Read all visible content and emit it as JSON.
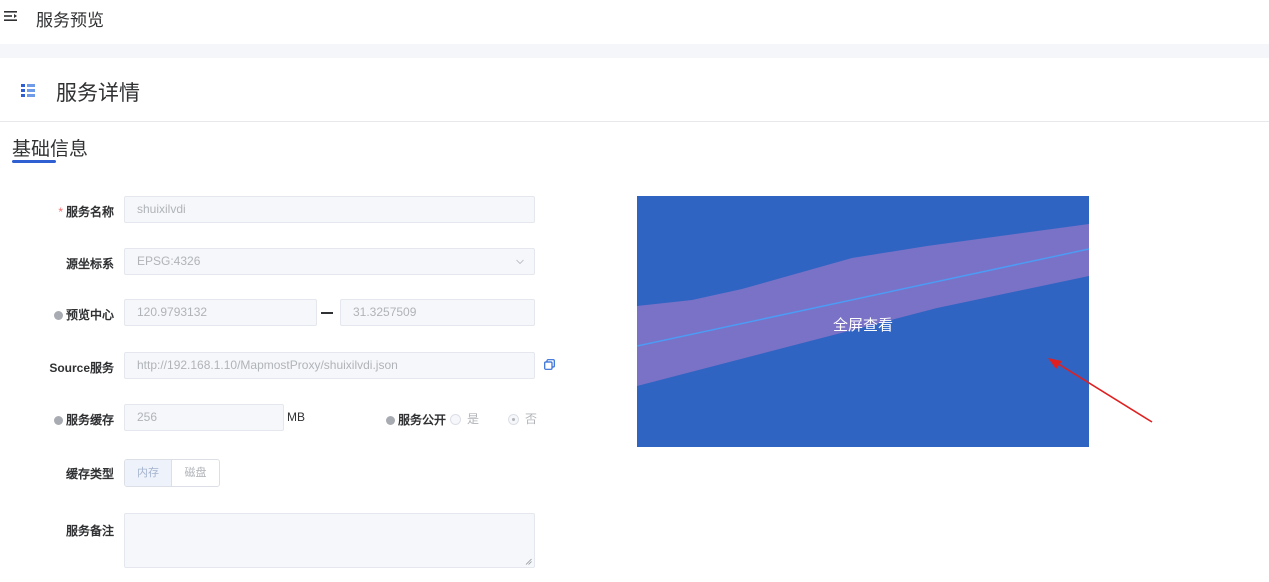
{
  "header": {
    "title": "服务预览",
    "menu_icon": "menu-fold-icon"
  },
  "section": {
    "title": "服务详情",
    "icon": "list-detail-icon"
  },
  "basic_info": {
    "title": "基础信息"
  },
  "form": {
    "service_name": {
      "label": "服务名称",
      "required_mark": "*",
      "value": "shuixilvdi"
    },
    "source_crs": {
      "label": "源坐标系",
      "value": "EPSG:4326"
    },
    "preview_center": {
      "label": "预览中心",
      "lon": "120.9793132",
      "lat": "31.3257509"
    },
    "source_service": {
      "label": "Source服务",
      "value": "http://192.168.1.10/MapmostProxy/shuixilvdi.json"
    },
    "service_cache": {
      "label": "服务缓存",
      "value": "256",
      "unit": "MB"
    },
    "service_public": {
      "label": "服务公开",
      "options": [
        "是",
        "否"
      ],
      "selected": "否"
    },
    "cache_type": {
      "label": "缓存类型",
      "options": [
        "内存",
        "磁盘"
      ],
      "selected": "内存"
    },
    "remark": {
      "label": "服务备注",
      "value": ""
    }
  },
  "map_preview": {
    "button_label": "全屏查看",
    "background": "#3064c3",
    "band_color": "#7a72c6",
    "line_color": "#4c9bf5"
  },
  "annotation": {
    "arrow_color": "#e02020"
  }
}
